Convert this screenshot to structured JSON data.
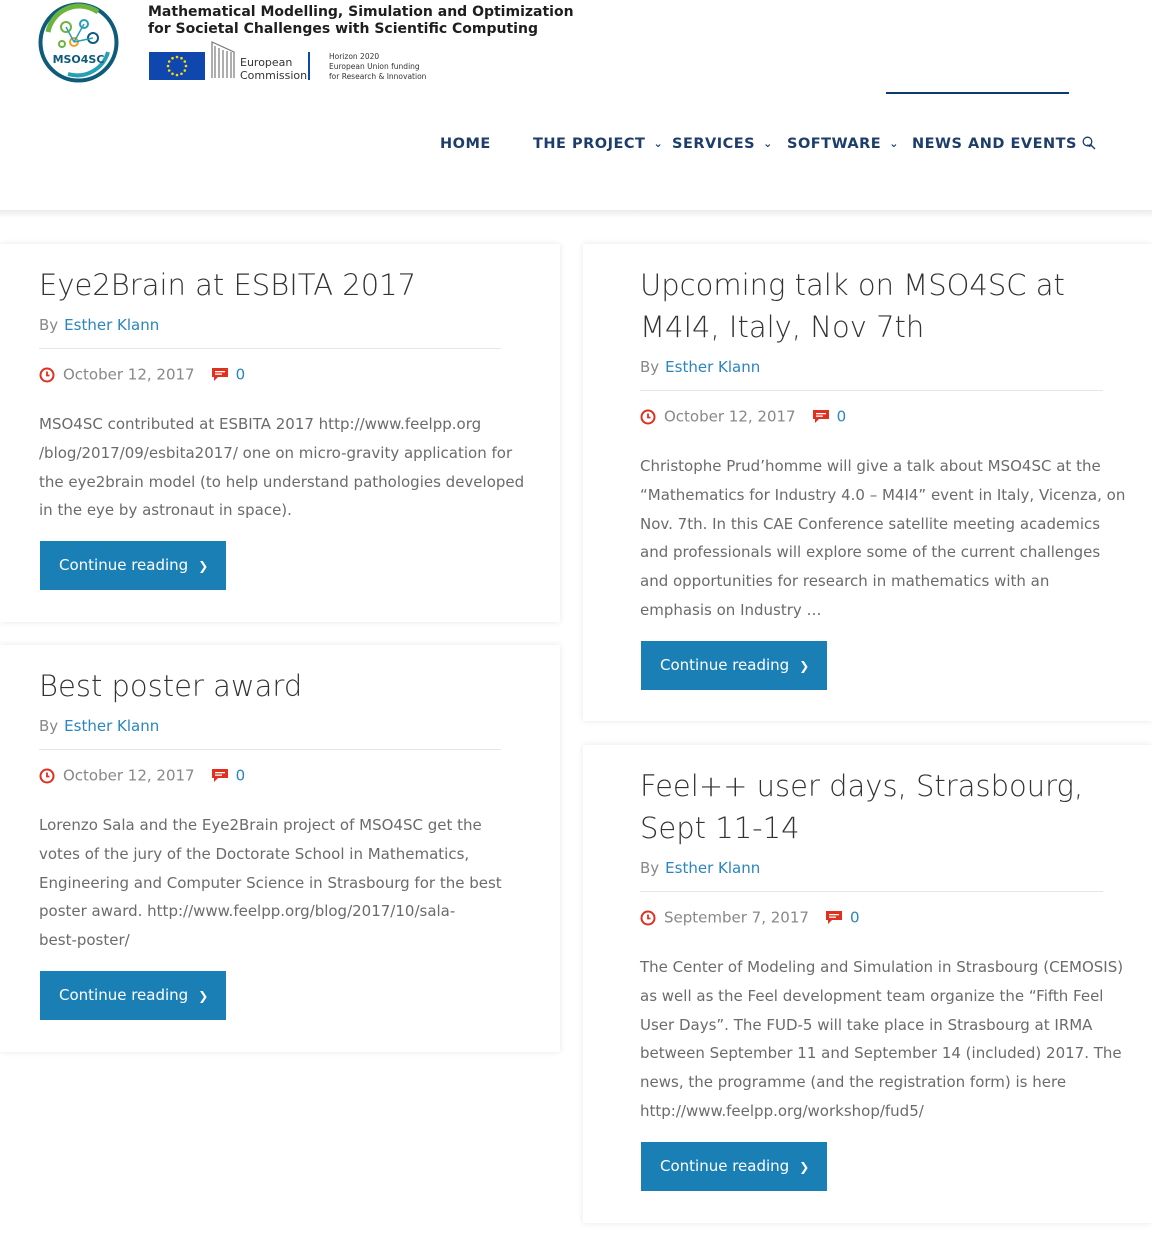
{
  "header": {
    "logo_text": "MSO4SC",
    "title_line1": "Mathematical Modelling, Simulation and Optimization",
    "title_line2": "for Societal Challenges with Scientific Computing",
    "eu_commission_line1": "European",
    "eu_commission_line2": "Commission",
    "h2020_line1": "Horizon 2020",
    "h2020_line2": "European Union funding",
    "h2020_line3": "for Research & Innovation"
  },
  "nav": {
    "items": [
      {
        "label": "HOME",
        "has_dropdown": false
      },
      {
        "label": "THE PROJECT",
        "has_dropdown": true
      },
      {
        "label": "SERVICES",
        "has_dropdown": true
      },
      {
        "label": "SOFTWARE",
        "has_dropdown": true
      },
      {
        "label": "NEWS AND EVENTS",
        "has_dropdown": true
      }
    ],
    "search_icon": "search-icon"
  },
  "posts": [
    {
      "title_lines": [
        "Eye2Brain at ESBITA 2017"
      ],
      "by": "By",
      "author": "Esther Klann",
      "date": "October 12, 2017",
      "comments": "0",
      "excerpt_lines": [
        "MSO4SC contributed at  ESBITA 2017 http://www.feelpp.org",
        "/blog/2017/09/esbita2017/ one on micro-gravity application for",
        "the eye2brain model (to help understand pathologies developed",
        "in the eye by astronaut in space)."
      ],
      "button": "Continue reading"
    },
    {
      "title_lines": [
        "Upcoming talk on MSO4SC at",
        "M4I4, Italy, Nov 7th"
      ],
      "by": "By",
      "author": "Esther Klann",
      "date": "October 12, 2017",
      "comments": "0",
      "excerpt_lines": [
        "Christophe Prud’homme will give a talk about MSO4SC at the",
        "“Mathematics for Industry 4.0 – M4I4” event in Italy, Vicenza, on",
        "Nov. 7th. In this CAE Conference satellite meeting academics",
        "and professionals will explore some of the current challenges",
        "and opportunities for research in mathematics with an",
        "emphasis on Industry …"
      ],
      "button": "Continue reading"
    },
    {
      "title_lines": [
        "Best poster award"
      ],
      "by": "By",
      "author": "Esther Klann",
      "date": "October 12, 2017",
      "comments": "0",
      "excerpt_lines": [
        "Lorenzo Sala and the Eye2Brain project of MSO4SC get the",
        "votes of the jury of the Doctorate School in Mathematics,",
        "Engineering and Computer Science in Strasbourg for the best",
        "poster award. http://www.feelpp.org/blog/2017/10/sala-",
        "best-poster/"
      ],
      "button": "Continue reading"
    },
    {
      "title_lines": [
        "Feel++ user days, Strasbourg,",
        "Sept 11-14"
      ],
      "by": "By",
      "author": "Esther Klann",
      "date": "September 7, 2017",
      "comments": "0",
      "excerpt_lines": [
        "The Center of Modeling and Simulation in Strasbourg (CEMOSIS)",
        "as well as the Feel development team organize the “Fifth Feel",
        "User Days”. The FUD-5 will take place in Strasbourg at IRMA",
        "between September 11 and September 14 (included) 2017. The",
        "news, the programme (and the registration form) is here",
        "http://www.feelpp.org/workshop/fud5/"
      ],
      "button": "Continue reading"
    }
  ],
  "colors": {
    "accent": "#1a7fb5",
    "nav_text": "#1d3d6b",
    "meta_icon": "#e0301e",
    "author_link": "#2a85c0"
  }
}
